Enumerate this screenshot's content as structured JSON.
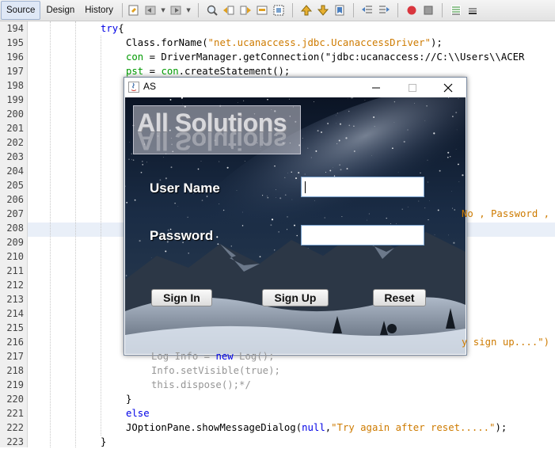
{
  "toolbar": {
    "tabs": [
      "Source",
      "Design",
      "History"
    ],
    "active_tab": "Source"
  },
  "editor": {
    "lines": [
      {
        "num": "194",
        "text": "try{"
      },
      {
        "num": "195",
        "text": "Class.forName(\"net.ucanaccess.jdbc.UcanaccessDriver\");"
      },
      {
        "num": "196",
        "text": "con = DriverManager.getConnection(\"jdbc:ucanaccess://C:\\\\Users\\\\ACER"
      },
      {
        "num": "197",
        "text": "pst = con.createStatement();"
      },
      {
        "num": "198",
        "text": ""
      },
      {
        "num": "199",
        "text": ""
      },
      {
        "num": "200",
        "text": ""
      },
      {
        "num": "201",
        "text": ""
      },
      {
        "num": "202",
        "text": ""
      },
      {
        "num": "203",
        "text": ""
      },
      {
        "num": "204",
        "text": ""
      },
      {
        "num": "205",
        "text": ""
      },
      {
        "num": "206",
        "text": ""
      },
      {
        "num": "207",
        "text": "No , Password ,"
      },
      {
        "num": "208",
        "text": ""
      },
      {
        "num": "209",
        "text": ""
      },
      {
        "num": "210",
        "text": ""
      },
      {
        "num": "211",
        "text": ""
      },
      {
        "num": "212",
        "text": ""
      },
      {
        "num": "213",
        "text": ""
      },
      {
        "num": "214",
        "text": ""
      },
      {
        "num": "215",
        "text": ""
      },
      {
        "num": "216",
        "text": "y sign up....\")"
      },
      {
        "num": "217",
        "text": "Log Info = new Log();"
      },
      {
        "num": "218",
        "text": "Info.setVisible(true);"
      },
      {
        "num": "219",
        "text": "this.dispose();*/"
      },
      {
        "num": "220",
        "text": "}"
      },
      {
        "num": "221",
        "text": "else"
      },
      {
        "num": "222",
        "text": "JOptionPane.showMessageDialog(null,\"Try again after reset.....\");"
      },
      {
        "num": "223",
        "text": "}"
      }
    ]
  },
  "dialog": {
    "title": "AS",
    "logo_text": "All Solutions",
    "username_label": "User Name",
    "password_label": "Password",
    "username_value": "",
    "password_value": "",
    "buttons": {
      "signin": "Sign In",
      "signup": "Sign Up",
      "reset": "Reset"
    }
  },
  "colors": {
    "keyword": "#0000e6",
    "string": "#ce7b00",
    "field": "#009900",
    "comment": "#969696",
    "sky_top": "#0b1424",
    "snow": "#dfe7f2"
  }
}
